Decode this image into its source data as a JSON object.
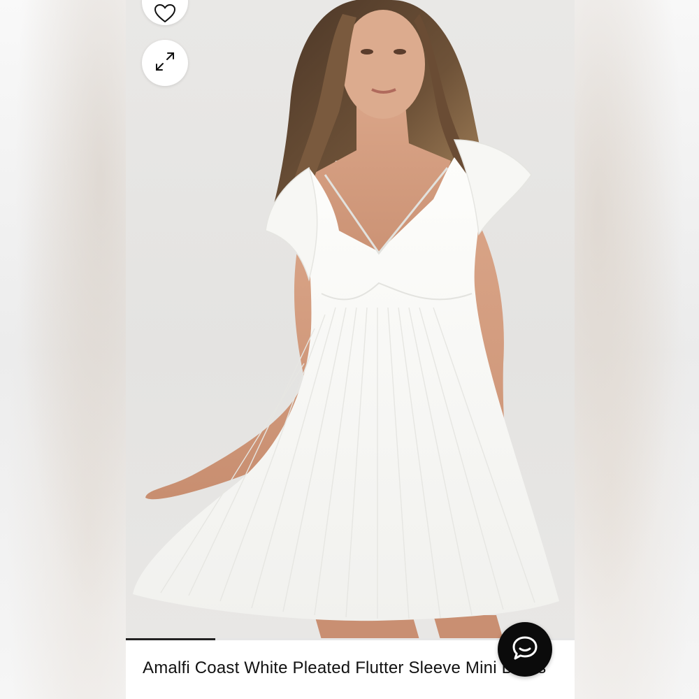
{
  "product": {
    "title": "Amalfi Coast White Pleated Flutter Sleeve Mini Dress"
  },
  "gallery": {
    "progress_fraction": 0.2,
    "photo_alt": "Model wearing a white pleated flutter sleeve mini dress"
  },
  "icons": {
    "favorite": "heart-icon",
    "expand": "expand-arrows-icon",
    "chat": "chat-bubble-icon"
  },
  "colors": {
    "dress": "#fbfbf9",
    "background": "#e7e6e4",
    "chat_button": "#0b0b0b",
    "progress": "#222222"
  }
}
